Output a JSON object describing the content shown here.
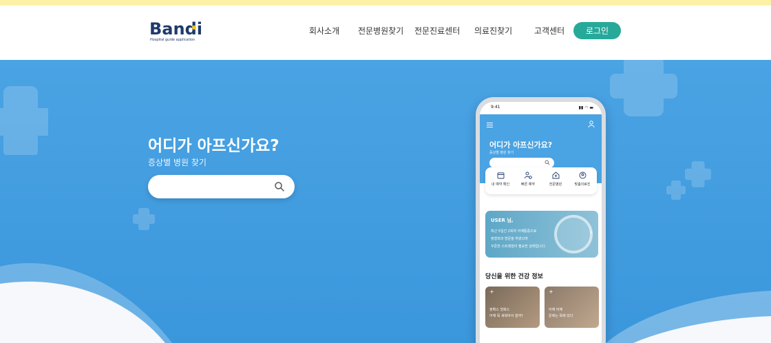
{
  "logo": {
    "brand": "Bandi",
    "tagline": "Hospital guide application"
  },
  "nav": {
    "items": [
      "회사소개",
      "전문병원찾기",
      "전문진료센터",
      "의료진찾기",
      "고객센터"
    ],
    "login": "로그인"
  },
  "hero": {
    "title": "어디가 아프신가요?",
    "subtitle": "증상별 병원 찾기",
    "search_placeholder": ""
  },
  "phone": {
    "time": "9:41",
    "app_title": "어디가 아프신가요?",
    "app_subtitle": "증상별 병원 찾기",
    "quick": [
      "내 예약 확인",
      "빠른 예약",
      "전문병원",
      "맞춤의료진"
    ],
    "banner": {
      "user": "USER 님,",
      "lines": [
        "최근 5일간 2회차 어깨통증으로",
        "정형외과 방문을 하였으며",
        "꾸준한 스트레칭이 필요한 상태입니다."
      ]
    },
    "section_title": "당신을 위한 건강 정보",
    "cards": [
      {
        "lines": [
          "정확스 젓화스",
          "어깨 목 세워야서 잘까?"
        ]
      },
      {
        "lines": [
          "어깨 어깨",
          "문제는 목에 있다"
        ]
      }
    ]
  },
  "colors": {
    "accent": "#27a99a",
    "hero_blue": "#4aa3e3",
    "top_strip": "#fdf1a6",
    "brand_navy": "#1f3a6b"
  }
}
